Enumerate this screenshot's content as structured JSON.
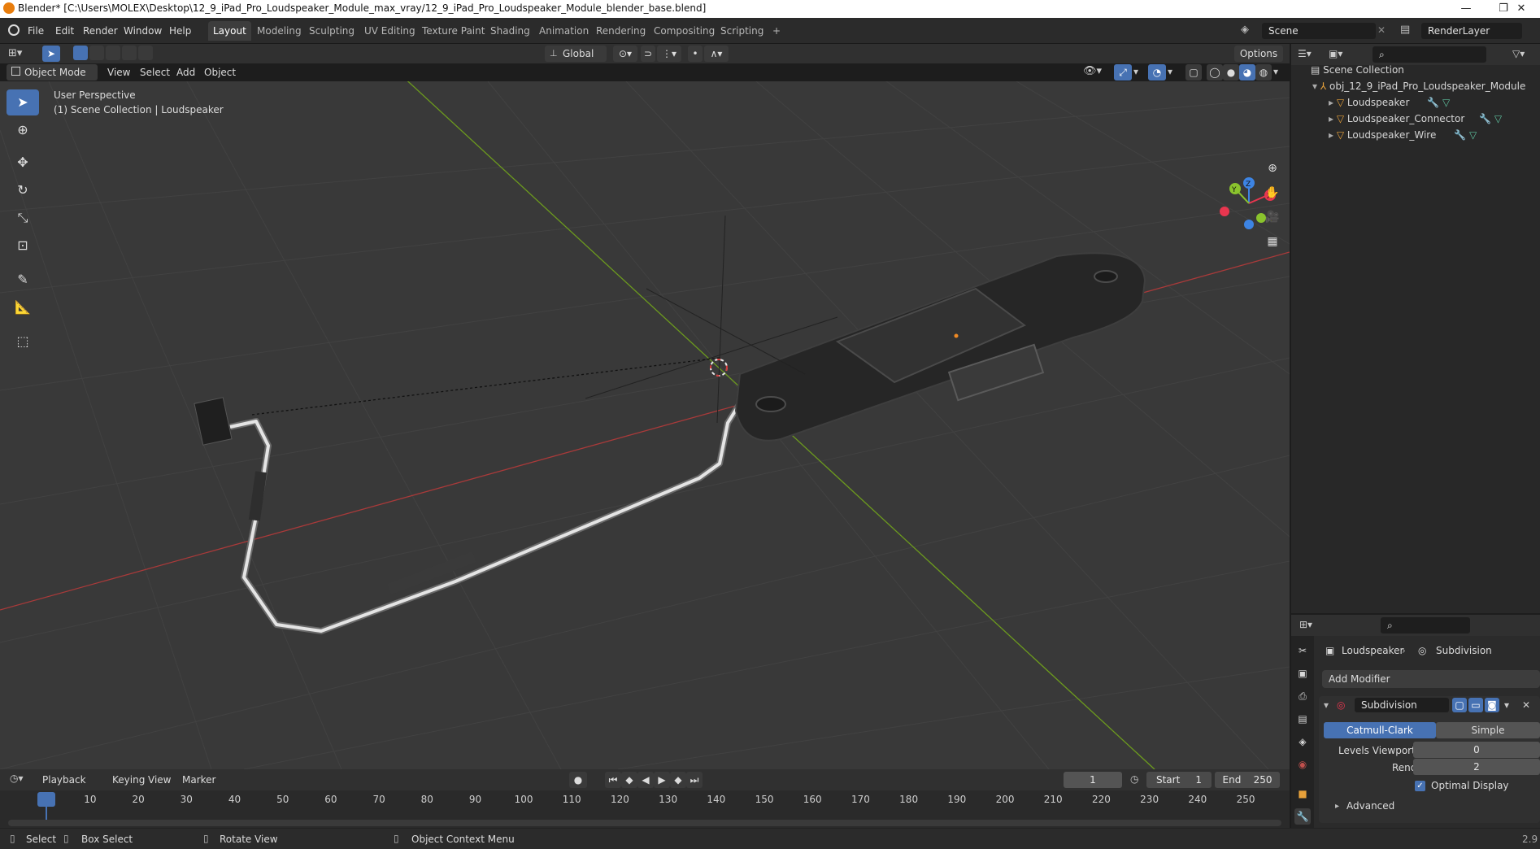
{
  "window": {
    "title": "Blender* [C:\\Users\\MOLEX\\Desktop\\12_9_iPad_Pro_Loudspeaker_Module_max_vray/12_9_iPad_Pro_Loudspeaker_Module_blender_base.blend]",
    "minimize": "—",
    "maximize": "❐",
    "close": "✕"
  },
  "menu": [
    "File",
    "Edit",
    "Render",
    "Window",
    "Help"
  ],
  "workspaces": [
    "Layout",
    "Modeling",
    "Sculpting",
    "UV Editing",
    "Texture Paint",
    "Shading",
    "Animation",
    "Rendering",
    "Compositing",
    "Scripting"
  ],
  "workspace_add": "+",
  "scene": {
    "name": "Scene",
    "render_layer": "RenderLayer"
  },
  "viewport_header": {
    "transform_orientation": "Global",
    "options": "Options",
    "mode": "Object Mode",
    "menus": [
      "View",
      "Select",
      "Add",
      "Object"
    ]
  },
  "viewport": {
    "perspective": "User Perspective",
    "collection_info": "(1) Scene Collection | Loudspeaker",
    "gizmo": {
      "x": "X",
      "y": "Y",
      "z": "Z"
    }
  },
  "outliner": {
    "root": "Scene Collection",
    "collection": "obj_12_9_iPad_Pro_Loudspeaker_Module",
    "objects": [
      "Loudspeaker",
      "Loudspeaker_Connector",
      "Loudspeaker_Wire"
    ]
  },
  "properties": {
    "object": "Loudspeaker",
    "modifier_breadcrumb": "Subdivision",
    "add_modifier": "Add Modifier",
    "modifier_name": "Subdivision",
    "type_options": [
      "Catmull-Clark",
      "Simple"
    ],
    "levels_viewport_label": "Levels Viewport",
    "levels_viewport": "0",
    "render_label": "Render",
    "render": "2",
    "optimal_display": "Optimal Display",
    "advanced": "Advanced"
  },
  "timeline": {
    "menus": [
      "Playback",
      "Keying",
      "View",
      "Marker"
    ],
    "current_frame": "1",
    "start_label": "Start",
    "start": "1",
    "end_label": "End",
    "end": "250",
    "ticks": [
      "1",
      "10",
      "20",
      "30",
      "40",
      "50",
      "60",
      "70",
      "80",
      "90",
      "100",
      "110",
      "120",
      "130",
      "140",
      "150",
      "160",
      "170",
      "180",
      "190",
      "200",
      "210",
      "220",
      "230",
      "240",
      "250"
    ]
  },
  "statusbar": {
    "select": "Select",
    "box_select": "Box Select",
    "rotate_view": "Rotate View",
    "context_menu": "Object Context Menu",
    "version": "2.9"
  },
  "colors": {
    "accent": "#4772b3",
    "grid_x": "#a83a3a",
    "grid_y": "#6c9a1e",
    "axis_x": "#e8364f",
    "axis_y": "#8ac32d",
    "axis_z": "#3d84e3"
  }
}
